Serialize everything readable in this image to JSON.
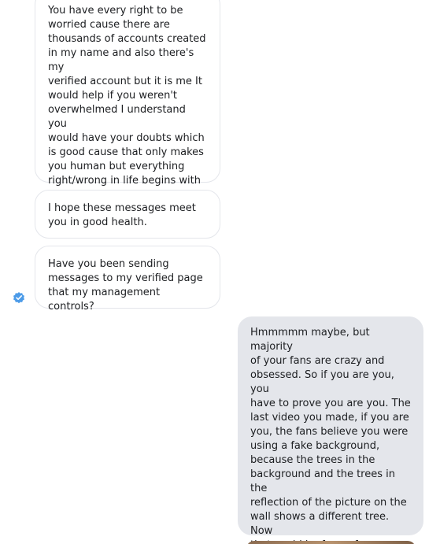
{
  "messages": [
    {
      "direction": "incoming",
      "text": "You have every right to be\nworried cause there are\nthousands of accounts created\nin my name and also there's my\nverified account but it is me It\nwould help if you weren't\noverwhelmed I understand you\nwould have your doubts which\nis good cause that only makes\nyou human but everything\nright/wrong in life begins with a\nlittle leap of faith."
    },
    {
      "direction": "incoming",
      "text": "I hope these messages meet\nyou in good health."
    },
    {
      "direction": "incoming",
      "text": "Have you been sending\nmessages to my verified page\nthat my management controls?"
    },
    {
      "direction": "outgoing",
      "text": "Hmmmmm maybe, but majority\nof your fans are crazy and\nobsessed. So if you are you, you\nhave to prove you are you. The\nlast video you made, if you are\nyou, the fans believe you were\nusing a fake background,\nbecause the trees in the\nbackground and the trees in the\nreflection of the picture on the\nwall shows a different tree. Now\nthat could be fore a few reason,\nbut despite their craziness your\nfans pay attention to everything."
    }
  ],
  "sender_badge": {
    "icon": "verified-check-icon",
    "color": "#4c9be8"
  },
  "colors": {
    "incoming_bg": "#ffffff",
    "incoming_border": "#e4e6eb",
    "outgoing_bg": "#e4e6eb",
    "text": "#1c1e21"
  }
}
